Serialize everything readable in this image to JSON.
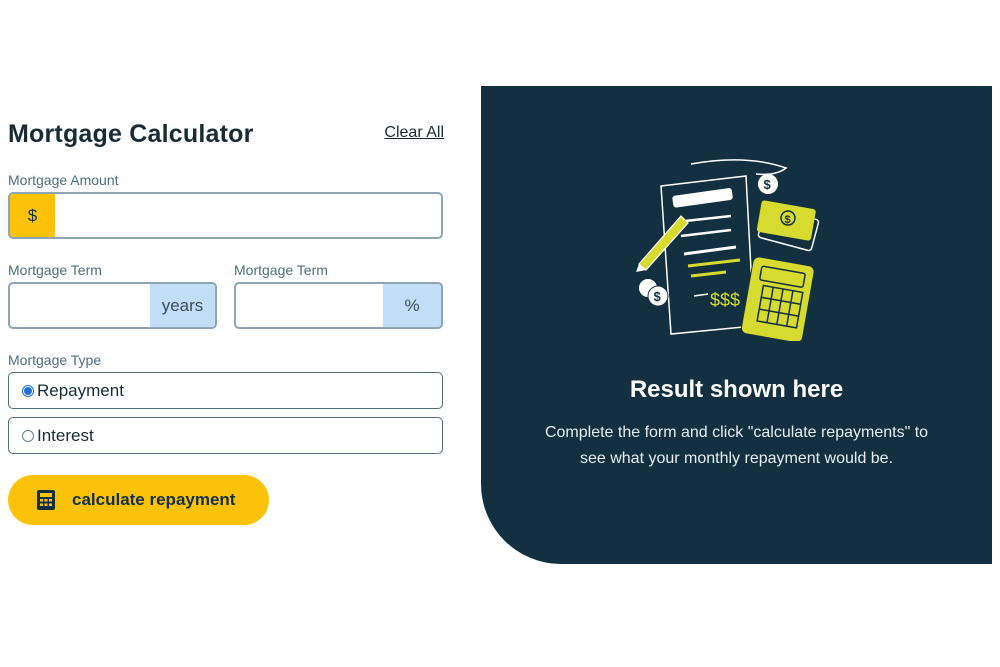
{
  "form": {
    "title": "Mortgage Calculator",
    "clear_all": "Clear All",
    "amount": {
      "label": "Mortgage Amount",
      "prefix": "$",
      "value": ""
    },
    "term": {
      "label": "Mortgage Term",
      "suffix": "years",
      "value": ""
    },
    "rate": {
      "label": "Mortgage Term",
      "suffix": "%",
      "value": ""
    },
    "type": {
      "label": "Mortgage Type",
      "options": [
        {
          "label": "Repayment",
          "checked": true
        },
        {
          "label": "Interest",
          "checked": false
        }
      ]
    },
    "submit_label": "calculate repayment"
  },
  "result": {
    "title": "Result shown here",
    "description": "Complete the form and click \"calculate repayments\" to see what your monthly repayment would be.",
    "illustration_text": "$$$"
  },
  "colors": {
    "accent_yellow": "#fcc208",
    "addon_blue": "#c2ddf7",
    "panel_dark": "#133040",
    "illustration_lime": "#d8db2f"
  }
}
